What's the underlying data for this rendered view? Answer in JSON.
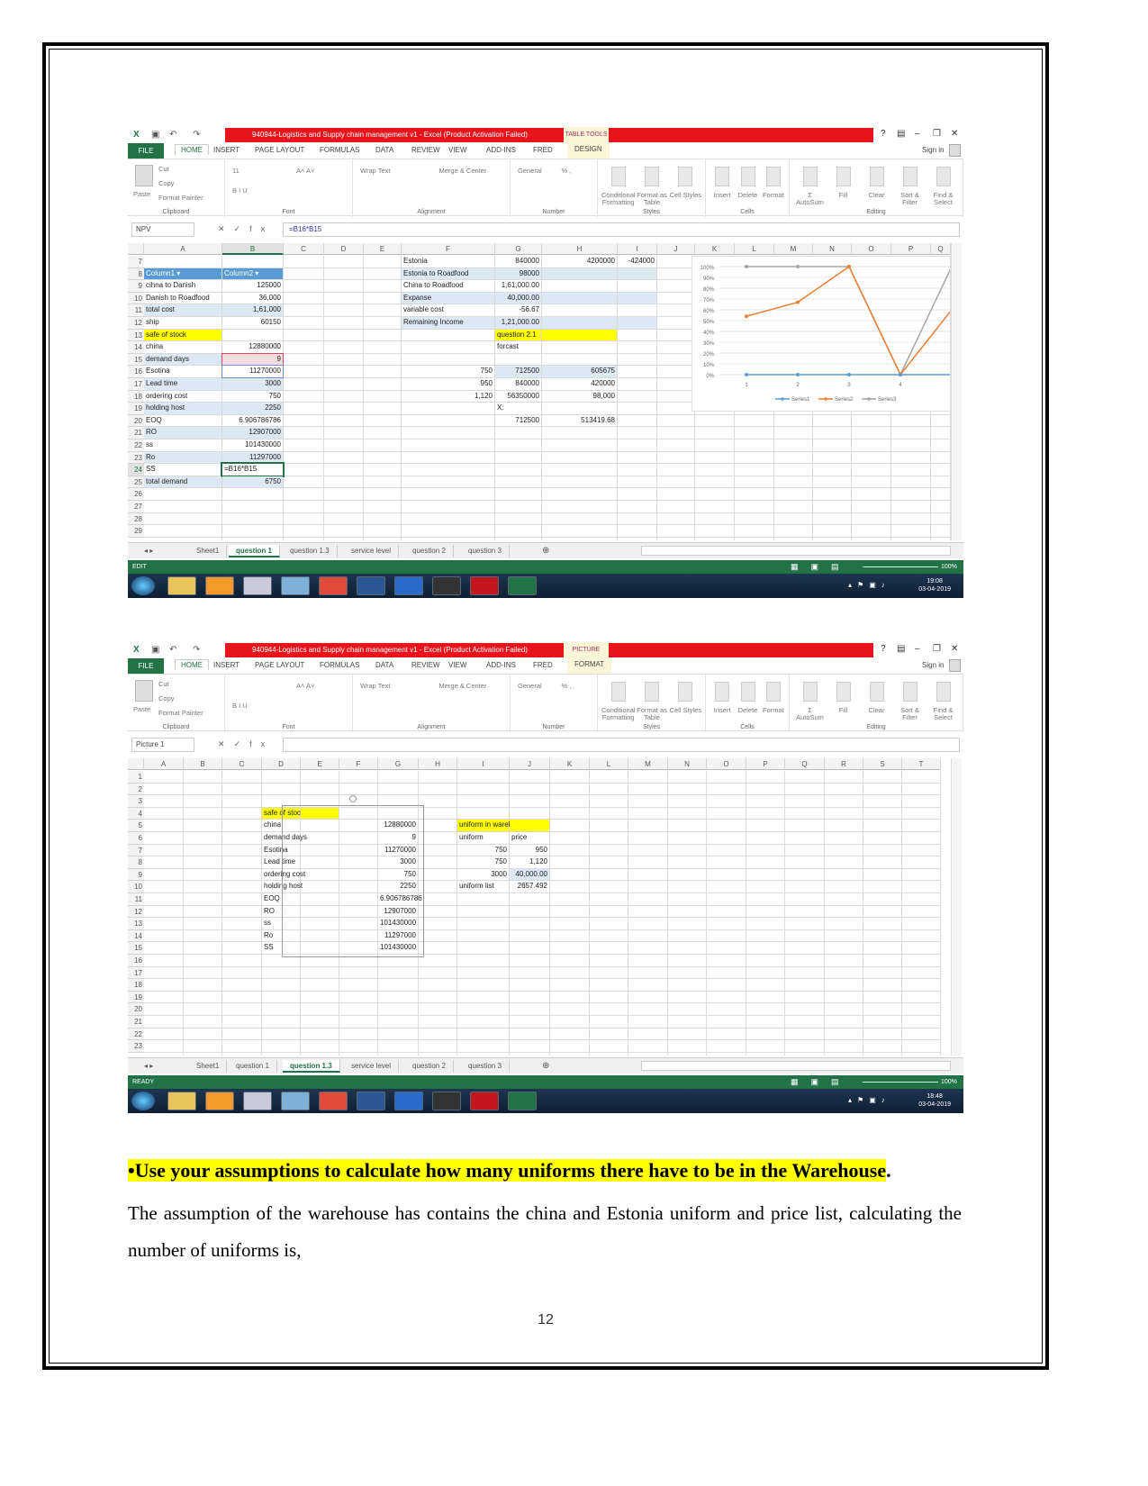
{
  "screenshots": [
    {
      "title": "940944-Logistics and Supply chain management v1 -  Excel (Product Activation Failed)",
      "context_group": "TABLE TOOLS",
      "tabs": [
        "FILE",
        "HOME",
        "INSERT",
        "PAGE LAYOUT",
        "FORMULAS",
        "DATA",
        "REVIEW",
        "VIEW",
        "ADD-INS",
        "FRED",
        "DESIGN"
      ],
      "sign_in": "Sign in",
      "ribbon_groups": [
        {
          "label": "Clipboard",
          "items": [
            "Paste",
            "Cut",
            "Copy",
            "Format Painter"
          ]
        },
        {
          "label": "Font",
          "items": [
            "11",
            "A˄ A˅",
            "B  I  U"
          ]
        },
        {
          "label": "Alignment",
          "items": [
            "Wrap Text",
            "Merge & Center"
          ]
        },
        {
          "label": "Number",
          "items": [
            "General",
            "% ,"
          ]
        },
        {
          "label": "Styles",
          "items": [
            "Conditional Formatting",
            "Format as Table",
            "Cell Styles"
          ]
        },
        {
          "label": "Cells",
          "items": [
            "Insert",
            "Delete",
            "Format"
          ]
        },
        {
          "label": "Editing",
          "items": [
            "Σ AutoSum",
            "Fill",
            "Clear",
            "Sort & Filter",
            "Find & Select"
          ]
        }
      ],
      "name_box": "NPV",
      "formula": "=B16*B15",
      "columns": [
        "A",
        "B",
        "C",
        "D",
        "E",
        "F",
        "G",
        "H",
        "I",
        "J",
        "K",
        "L",
        "M",
        "N",
        "O",
        "P",
        "Q"
      ],
      "selected_column": "B",
      "rows": [
        7,
        8,
        9,
        10,
        11,
        12,
        13,
        14,
        15,
        16,
        17,
        18,
        19,
        20,
        21,
        22,
        23,
        24,
        25,
        26,
        27,
        28,
        29
      ],
      "active_row": 24,
      "cells": [
        {
          "ref": "F7",
          "v": "Estonia"
        },
        {
          "ref": "G7",
          "v": "840000",
          "r": 1
        },
        {
          "ref": "H7",
          "v": "4200000",
          "r": 1
        },
        {
          "ref": "I7",
          "v": "-424000",
          "r": 1
        },
        {
          "ref": "A8",
          "v": "Column1 ▾",
          "s": "hdr"
        },
        {
          "ref": "B8",
          "v": "Column2 ▾",
          "s": "hdr"
        },
        {
          "ref": "F8",
          "v": "Estonia to Roadfood",
          "s": "band"
        },
        {
          "ref": "G8",
          "v": "98000",
          "r": 1,
          "s": "band"
        },
        {
          "ref": "H8",
          "v": "",
          "s": "band"
        },
        {
          "ref": "I8",
          "v": "",
          "s": "band"
        },
        {
          "ref": "A9",
          "v": "cihna to Danish"
        },
        {
          "ref": "B9",
          "v": "125000",
          "r": 1
        },
        {
          "ref": "F9",
          "v": "China to Roadfood"
        },
        {
          "ref": "G9",
          "v": "1,61,000.00",
          "r": 1
        },
        {
          "ref": "A10",
          "v": "Danish to Roadfood"
        },
        {
          "ref": "B10",
          "v": "36,000",
          "r": 1
        },
        {
          "ref": "F10",
          "v": "Expanse",
          "s": "band"
        },
        {
          "ref": "G10",
          "v": "40,000.00",
          "r": 1,
          "s": "band"
        },
        {
          "ref": "H10",
          "v": "",
          "s": "band"
        },
        {
          "ref": "I10",
          "v": "",
          "s": "band"
        },
        {
          "ref": "A11",
          "v": "total cost",
          "s": "band"
        },
        {
          "ref": "B11",
          "v": "1,61,000",
          "r": 1,
          "s": "band"
        },
        {
          "ref": "F11",
          "v": "variable cost"
        },
        {
          "ref": "G11",
          "v": "-56.67",
          "r": 1
        },
        {
          "ref": "A12",
          "v": "ship"
        },
        {
          "ref": "B12",
          "v": "60150",
          "r": 1
        },
        {
          "ref": "F12",
          "v": "Remaining Income",
          "s": "band"
        },
        {
          "ref": "G12",
          "v": "1,21,000.00",
          "r": 1,
          "s": "band"
        },
        {
          "ref": "H12",
          "v": "",
          "s": "band"
        },
        {
          "ref": "I12",
          "v": "",
          "s": "band"
        },
        {
          "ref": "A13",
          "v": "safe of stock",
          "s": "yel"
        },
        {
          "ref": "G13",
          "v": "question 2.1",
          "s": "yel"
        },
        {
          "ref": "H13",
          "v": "",
          "s": "yel"
        },
        {
          "ref": "A14",
          "v": "china"
        },
        {
          "ref": "B14",
          "v": "12880000",
          "r": 1
        },
        {
          "ref": "G14",
          "v": "forcast"
        },
        {
          "ref": "A15",
          "v": "demand days",
          "s": "band"
        },
        {
          "ref": "B15",
          "v": "9",
          "r": 1,
          "s": "sel"
        },
        {
          "ref": "A16",
          "v": "Esotina"
        },
        {
          "ref": "B16",
          "v": "11270000",
          "r": 1,
          "s": "sel2"
        },
        {
          "ref": "F16",
          "v": "750",
          "r": 1
        },
        {
          "ref": "G16",
          "v": "712500",
          "r": 1,
          "s": "band"
        },
        {
          "ref": "H16",
          "v": "605675",
          "r": 1,
          "s": "band"
        },
        {
          "ref": "A17",
          "v": "Lead time",
          "s": "band"
        },
        {
          "ref": "B17",
          "v": "3000",
          "r": 1,
          "s": "band"
        },
        {
          "ref": "F17",
          "v": "950",
          "r": 1
        },
        {
          "ref": "G17",
          "v": "840000",
          "r": 1
        },
        {
          "ref": "H17",
          "v": "420000",
          "r": 1
        },
        {
          "ref": "A18",
          "v": "ordering cost"
        },
        {
          "ref": "B18",
          "v": "750",
          "r": 1
        },
        {
          "ref": "F18",
          "v": "1,120",
          "r": 1
        },
        {
          "ref": "G18",
          "v": "56350000",
          "r": 1
        },
        {
          "ref": "H18",
          "v": "98,000",
          "r": 1
        },
        {
          "ref": "A19",
          "v": "holding host",
          "s": "band"
        },
        {
          "ref": "B19",
          "v": "2250",
          "r": 1,
          "s": "band"
        },
        {
          "ref": "G19",
          "v": "X:"
        },
        {
          "ref": "A20",
          "v": "EOQ"
        },
        {
          "ref": "B20",
          "v": "6.906786786",
          "r": 1
        },
        {
          "ref": "G20",
          "v": "712500",
          "r": 1
        },
        {
          "ref": "H20",
          "v": "513419.68",
          "r": 1
        },
        {
          "ref": "A21",
          "v": "RO",
          "s": "band"
        },
        {
          "ref": "B21",
          "v": "12907000",
          "r": 1,
          "s": "band"
        },
        {
          "ref": "A22",
          "v": "ss"
        },
        {
          "ref": "B22",
          "v": "101430000",
          "r": 1
        },
        {
          "ref": "A23",
          "v": "Ro",
          "s": "band"
        },
        {
          "ref": "B23",
          "v": "11297000",
          "r": 1,
          "s": "band"
        },
        {
          "ref": "A24",
          "v": "SS"
        },
        {
          "ref": "B24",
          "v": "=B16*B15",
          "s": "act"
        },
        {
          "ref": "A25",
          "v": "total demand",
          "s": "band"
        },
        {
          "ref": "B25",
          "v": "6750",
          "r": 1,
          "s": "band"
        }
      ],
      "chart": {
        "type": "line",
        "x": [
          1,
          2,
          3,
          4,
          5
        ],
        "y_ticks": [
          "0%",
          "10%",
          "20%",
          "30%",
          "40%",
          "50%",
          "60%",
          "70%",
          "80%",
          "90%",
          "100%"
        ],
        "ylim": [
          0,
          100
        ],
        "legend_placement": "bottom",
        "series": [
          {
            "name": "Series1",
            "color": "#5b9bd5",
            "values": [
              0,
              0,
              0,
              0,
              0
            ]
          },
          {
            "name": "Series2",
            "color": "#ed7d31",
            "values": [
              54,
              67,
              100,
              0,
              60
            ]
          },
          {
            "name": "Series3",
            "color": "#a5a5a5",
            "values": [
              100,
              100,
              100,
              0,
              100
            ]
          }
        ]
      },
      "sheet_tabs": [
        "Sheet1",
        "question 1",
        "question 1.3",
        "service level",
        "question 2",
        "question 3"
      ],
      "active_sheet": "question 1",
      "status": "EDIT",
      "zoom": "100%",
      "clock_time": "19:08",
      "clock_date": "03-04-2019"
    },
    {
      "title": "940944-Logistics and Supply chain management v1 -  Excel (Product Activation Failed)",
      "context_group": "PICTURE TOOLS",
      "tabs": [
        "FILE",
        "HOME",
        "INSERT",
        "PAGE LAYOUT",
        "FORMULAS",
        "DATA",
        "REVIEW",
        "VIEW",
        "ADD-INS",
        "FRED",
        "FORMAT"
      ],
      "sign_in": "Sign in",
      "ribbon_groups": [
        {
          "label": "Clipboard",
          "items": [
            "Paste",
            "Cut",
            "Copy",
            "Format Painter"
          ]
        },
        {
          "label": "Font",
          "items": [
            "",
            "A˄ A˅",
            "B  I  U"
          ]
        },
        {
          "label": "Alignment",
          "items": [
            "Wrap Text",
            "Merge & Center"
          ]
        },
        {
          "label": "Number",
          "items": [
            "General",
            "% ,"
          ]
        },
        {
          "label": "Styles",
          "items": [
            "Conditional Formatting",
            "Format as Table",
            "Cell Styles"
          ]
        },
        {
          "label": "Cells",
          "items": [
            "Insert",
            "Delete",
            "Format"
          ]
        },
        {
          "label": "Editing",
          "items": [
            "Σ AutoSum",
            "Fill",
            "Clear",
            "Sort & Filter",
            "Find & Select"
          ]
        }
      ],
      "name_box": "Picture 1",
      "formula": "",
      "columns": [
        "A",
        "B",
        "C",
        "D",
        "E",
        "F",
        "G",
        "H",
        "I",
        "J",
        "K",
        "L",
        "M",
        "N",
        "O",
        "P",
        "Q",
        "R",
        "S",
        "T"
      ],
      "selected_column": "",
      "rows": [
        1,
        2,
        3,
        4,
        5,
        6,
        7,
        8,
        9,
        10,
        11,
        12,
        13,
        14,
        15,
        16,
        17,
        18,
        19,
        20,
        21,
        22,
        23
      ],
      "active_row": 0,
      "cells": [
        {
          "ref": "D4",
          "v": "safe of stock",
          "s": "yel"
        },
        {
          "ref": "E4",
          "v": "",
          "s": "yel"
        },
        {
          "ref": "D5",
          "v": "china"
        },
        {
          "ref": "G5",
          "v": "12880000",
          "r": 1
        },
        {
          "ref": "D6",
          "v": "demand days"
        },
        {
          "ref": "G6",
          "v": "9",
          "r": 1
        },
        {
          "ref": "D7",
          "v": "Esotina"
        },
        {
          "ref": "G7",
          "v": "11270000",
          "r": 1
        },
        {
          "ref": "D8",
          "v": "Lead time"
        },
        {
          "ref": "G8",
          "v": "3000",
          "r": 1
        },
        {
          "ref": "D9",
          "v": "ordering cost"
        },
        {
          "ref": "G9",
          "v": "750",
          "r": 1
        },
        {
          "ref": "D10",
          "v": "holding host"
        },
        {
          "ref": "G10",
          "v": "2250",
          "r": 1
        },
        {
          "ref": "D11",
          "v": "EOQ"
        },
        {
          "ref": "G11",
          "v": "6.906786786",
          "r": 1
        },
        {
          "ref": "D12",
          "v": "RO"
        },
        {
          "ref": "G12",
          "v": "12907000",
          "r": 1
        },
        {
          "ref": "D13",
          "v": "ss"
        },
        {
          "ref": "G13",
          "v": "101430000",
          "r": 1
        },
        {
          "ref": "D14",
          "v": "Ro"
        },
        {
          "ref": "G14",
          "v": "11297000",
          "r": 1
        },
        {
          "ref": "D15",
          "v": "SS"
        },
        {
          "ref": "G15",
          "v": "101430000",
          "r": 1
        },
        {
          "ref": "I5",
          "v": "uniform in warehouse",
          "s": "yel"
        },
        {
          "ref": "J5",
          "v": "",
          "s": "yel"
        },
        {
          "ref": "I6",
          "v": "uniform"
        },
        {
          "ref": "J6",
          "v": "price"
        },
        {
          "ref": "I7",
          "v": "750",
          "r": 1
        },
        {
          "ref": "J7",
          "v": "950",
          "r": 1
        },
        {
          "ref": "I8",
          "v": "750",
          "r": 1
        },
        {
          "ref": "J8",
          "v": "1,120",
          "r": 1
        },
        {
          "ref": "I9",
          "v": "3000",
          "r": 1
        },
        {
          "ref": "J9",
          "v": "40,000.00",
          "r": 1,
          "s": "band"
        },
        {
          "ref": "I10",
          "v": "uniform list"
        },
        {
          "ref": "J10",
          "v": "2657.492",
          "r": 1
        }
      ],
      "sheet_tabs": [
        "Sheet1",
        "question 1",
        "question 1.3",
        "service level",
        "question 2",
        "question 3"
      ],
      "active_sheet": "question 1.3",
      "status": "READY",
      "zoom": "100%",
      "clock_time": "18:48",
      "clock_date": "03-04-2019"
    }
  ],
  "document": {
    "heading_bullet": "•Use your assumptions to calculate how many uniforms there have to be in the Warehouse",
    "heading_end": ".",
    "paragraph": "The assumption of the warehouse has contains the china and Estonia uniform and price list, calculating the number of uniforms is,",
    "page_number": "12"
  },
  "colors": {
    "excel_green": "#217346",
    "title_red": "#e8141b",
    "highlight": "#ffff00"
  }
}
